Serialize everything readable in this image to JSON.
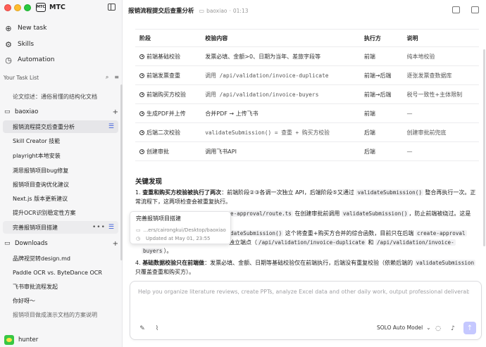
{
  "app": {
    "name": "MTC",
    "logo_text": "MTC"
  },
  "nav": [
    {
      "label": "New task",
      "icon": "new-task-icon"
    },
    {
      "label": "Skills",
      "icon": "skills-icon"
    },
    {
      "label": "Automation",
      "icon": "automation-icon"
    }
  ],
  "task_list": {
    "header": "Your Task List",
    "partial_item": "论文综述：通俗易懂的结构化文档",
    "groups": [
      {
        "name": "baoxiao",
        "items": [
          {
            "label": "报销流程提交后查重分析",
            "active": true
          },
          {
            "label": "Skill Creator 技能"
          },
          {
            "label": "playright本地安装"
          },
          {
            "label": "溯思报销项目bug修复"
          },
          {
            "label": "报销项目查询优化建议"
          },
          {
            "label": "Next.js 版本更新建议"
          },
          {
            "label": "提升OCR识别稳定性方案"
          },
          {
            "label": "完善报销项目搭建",
            "hovered": true
          }
        ]
      },
      {
        "name": "Downloads",
        "items": [
          {
            "label": "品牌视觉转design.md"
          },
          {
            "label": "Paddle OCR vs. ByteDance OCR"
          },
          {
            "label": "飞书审批流程发起"
          },
          {
            "label": "你好呀～"
          },
          {
            "label": "报销项目做成演示文档的方案说明"
          }
        ]
      }
    ]
  },
  "hover_card": {
    "title": "完善报销项目搭建",
    "path": "...ers/cairongkui/Desktop/baoxiao",
    "updated": "Updated at May 01, 23:55"
  },
  "user": {
    "name": "hunter"
  },
  "header": {
    "title": "报销流程提交后查重分析",
    "folder": "baoxiao",
    "separator": "·",
    "time": "01:13"
  },
  "table": {
    "headers": [
      "阶段",
      "校验内容",
      "执行方",
      "说明"
    ],
    "rows": [
      {
        "stage": "前端基础校验",
        "content": "发票必填、金额>0、日期为当年、差旅字段等",
        "mono": false,
        "executor": "前端",
        "note": "纯本地校验"
      },
      {
        "stage": "前端发票查重",
        "content": "调用 /api/validation/invoice-duplicate",
        "mono": true,
        "executor": "前端→后端",
        "note": "逐张发票查数据库"
      },
      {
        "stage": "前端购买方校验",
        "content": "调用 /api/validation/invoice-buyers",
        "mono": true,
        "executor": "前端→后端",
        "note": "税号一致性+主体限制"
      },
      {
        "stage": "生成PDF并上传",
        "content": "合并PDF → 上传飞书",
        "mono": false,
        "executor": "前端",
        "note": "—"
      },
      {
        "stage": "后端二次校验",
        "content": "validateSubmission() = 查重 + 购买方校验",
        "mono": true,
        "executor": "后端",
        "note": "创建审批前兜底"
      },
      {
        "stage": "创建审批",
        "content": "调用飞书API",
        "mono": false,
        "executor": "后端",
        "note": "—"
      }
    ]
  },
  "findings": {
    "title": "关键发现",
    "f1_num": "1.",
    "f1_bold": "查重和购买方校验被执行了两次",
    "f1_text_a": "：前端阶段②③各调一次独立 API，后端阶段⑤又通过 ",
    "f1_code_a": "validateSubmission()",
    "f1_text_b": " 整合再执行一次。正常流程下，这两项检查会被重复执行。",
    "f1_l2_code": "e-approval/route.ts",
    "f1_l2_text_a": " 在创建审批前调用 ",
    "f1_l2_code_b": "validateSubmission()",
    "f1_l2_text_b": "，防止前端被绕过。这是",
    "f1_l3_code": "dateSubmission()",
    "f1_l3_text_a": " 这个将查重+购买方合并的综合函数，目前只在后端 ",
    "f1_l3_code_b": "create-approval",
    "f1_l4_text_a": "独立端点（",
    "f1_l4_code_a": "/api/validation/invoice-duplicate",
    "f1_l4_text_b": " 和 ",
    "f1_l4_code_b": "/api/validation/invoice-",
    "f1_l5_code": "buyers",
    "f1_l5_text": "）。",
    "f2_num": "4.",
    "f2_bold": "基础数据校验只在前端做",
    "f2_text_a": "：发票必填、金额、日期等基础校验仅在前端执行，后端没有重复校验（依赖后端的 ",
    "f2_code": "validateSubmission",
    "f2_text_b": " 只覆盖查重和购买方）。"
  },
  "composer": {
    "placeholder": "Help you organize literature reviews, create PPTs, analyze Excel data and other daily work, output professional deliverables.",
    "model": "SOLO Auto Model"
  },
  "colors": {
    "accent": "#3b5bdb",
    "send_button": "#c5c8ff",
    "sidebar_bg": "#f6f6f7"
  }
}
